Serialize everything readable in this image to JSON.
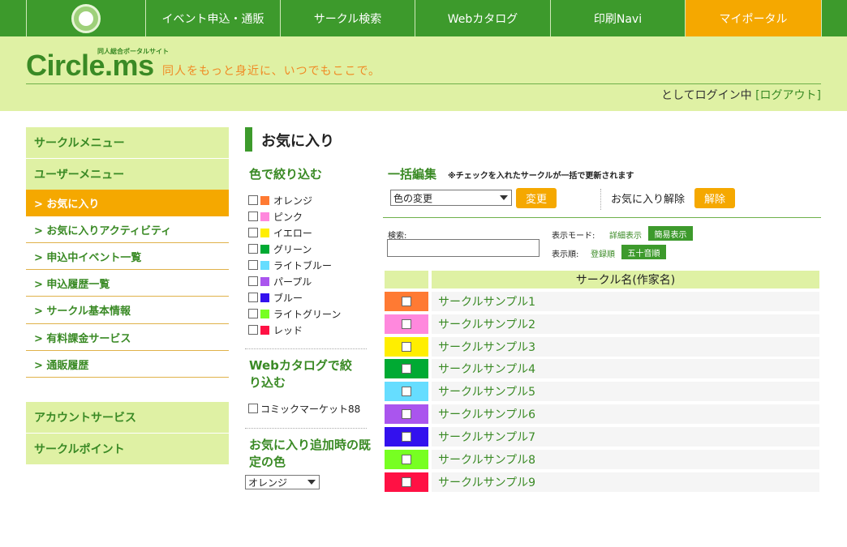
{
  "nav": {
    "logo_text": "circle.ms",
    "items": [
      {
        "label": "イベント申込・通販"
      },
      {
        "label": "サークル検索"
      },
      {
        "label": "Webカタログ"
      },
      {
        "label": "印刷Navi"
      },
      {
        "label": "マイポータル",
        "active": true
      }
    ]
  },
  "header": {
    "brand": "Circle.ms",
    "brand_sub": "同人総合ポータルサイト",
    "tagline": "同人をもっと身近に、いつでもここで。",
    "login_text": "としてログイン中",
    "logout_label": "[ログアウト]"
  },
  "sidebar": {
    "circle_menu": "サークルメニュー",
    "user_menu": "ユーザーメニュー",
    "items": [
      {
        "label": "> お気に入り",
        "active": true
      },
      {
        "label": "> お気に入りアクティビティ"
      },
      {
        "label": "> 申込中イベント一覧"
      },
      {
        "label": "> 申込履歴一覧"
      },
      {
        "label": "> サークル基本情報"
      },
      {
        "label": "> 有料課金サービス"
      },
      {
        "label": "> 通販履歴"
      }
    ],
    "account_service": "アカウントサービス",
    "circle_point": "サークルポイント"
  },
  "page": {
    "title": "お気に入り"
  },
  "filters": {
    "color_title": "色で絞り込む",
    "colors": [
      {
        "label": "オレンジ",
        "color": "#ff7a33"
      },
      {
        "label": "ピンク",
        "color": "#ff88dd"
      },
      {
        "label": "イエロー",
        "color": "#ffee00"
      },
      {
        "label": "グリーン",
        "color": "#00aa33"
      },
      {
        "label": "ライトブルー",
        "color": "#66ddff"
      },
      {
        "label": "パープル",
        "color": "#aa55ee"
      },
      {
        "label": "ブルー",
        "color": "#3311ee"
      },
      {
        "label": "ライトグリーン",
        "color": "#77ff22"
      },
      {
        "label": "レッド",
        "color": "#ff1144"
      }
    ],
    "catalog_title": "Webカタログで絞り込む",
    "catalog_items": [
      {
        "label": "コミックマーケット88"
      }
    ],
    "default_color_title": "お気に入り追加時の既定の色",
    "default_color_value": "オレンジ"
  },
  "bulk": {
    "title": "一括編集",
    "note": "※チェックを入れたサークルが一括で更新されます",
    "color_select_value": "色の変更",
    "change_button": "変更",
    "unfavorite_label": "お気に入り解除",
    "unfavorite_button": "解除"
  },
  "search": {
    "label": "検索:",
    "value": "",
    "display_mode_label": "表示モード:",
    "display_detail": "詳細表示",
    "display_simple": "簡易表示",
    "order_label": "表示順:",
    "order_registered": "登録順",
    "order_kana": "五十音順"
  },
  "table": {
    "header": "サークル名(作家名)",
    "rows": [
      {
        "name": "サークルサンプル1",
        "color": "#ff7a33"
      },
      {
        "name": "サークルサンプル2",
        "color": "#ff88dd"
      },
      {
        "name": "サークルサンプル3",
        "color": "#ffee00"
      },
      {
        "name": "サークルサンプル4",
        "color": "#00aa33"
      },
      {
        "name": "サークルサンプル5",
        "color": "#66ddff"
      },
      {
        "name": "サークルサンプル6",
        "color": "#aa55ee"
      },
      {
        "name": "サークルサンプル7",
        "color": "#3311ee"
      },
      {
        "name": "サークルサンプル8",
        "color": "#77ff22"
      },
      {
        "name": "サークルサンプル9",
        "color": "#ff1144"
      }
    ]
  }
}
